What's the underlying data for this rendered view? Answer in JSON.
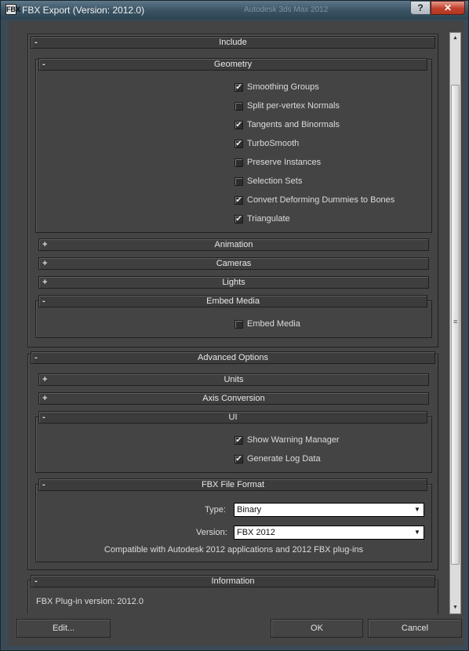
{
  "window": {
    "title": "FBX Export (Version: 2012.0)",
    "icon_label": "FBX",
    "background_title": "Autodesk 3ds Max  2012",
    "help_label": "?",
    "close_label": "✕"
  },
  "include": {
    "label": "Include",
    "toggle": "-",
    "geometry": {
      "label": "Geometry",
      "toggle": "-",
      "options": [
        {
          "label": "Smoothing Groups",
          "checked": true
        },
        {
          "label": "Split per-vertex Normals",
          "checked": false
        },
        {
          "label": "Tangents and Binormals",
          "checked": true
        },
        {
          "label": "TurboSmooth",
          "checked": true
        },
        {
          "label": "Preserve Instances",
          "checked": false
        },
        {
          "label": "Selection Sets",
          "checked": false
        },
        {
          "label": "Convert Deforming Dummies to Bones",
          "checked": true
        },
        {
          "label": "Triangulate",
          "checked": true
        }
      ]
    },
    "animation": {
      "label": "Animation",
      "toggle": "+"
    },
    "cameras": {
      "label": "Cameras",
      "toggle": "+"
    },
    "lights": {
      "label": "Lights",
      "toggle": "+"
    },
    "embed_media": {
      "label": "Embed Media",
      "toggle": "-",
      "option": {
        "label": "Embed Media",
        "checked": false
      }
    }
  },
  "advanced": {
    "label": "Advanced Options",
    "toggle": "-",
    "units": {
      "label": "Units",
      "toggle": "+"
    },
    "axis_conversion": {
      "label": "Axis Conversion",
      "toggle": "+"
    },
    "ui": {
      "label": "UI",
      "toggle": "-",
      "options": [
        {
          "label": "Show Warning Manager",
          "checked": true
        },
        {
          "label": "Generate Log Data",
          "checked": true
        }
      ]
    },
    "fbx_file_format": {
      "label": "FBX File Format",
      "toggle": "-",
      "type_label": "Type:",
      "type_value": "Binary",
      "version_label": "Version:",
      "version_value": "FBX 2012",
      "note": "Compatible with Autodesk 2012 applications and 2012 FBX plug-ins"
    }
  },
  "information": {
    "label": "Information",
    "toggle": "-",
    "plugin_version": "FBX Plug-in version: 2012.0"
  },
  "buttons": {
    "edit": "Edit...",
    "ok": "OK",
    "cancel": "Cancel"
  },
  "scrollbar": {
    "up": "▲",
    "down": "▼",
    "grip": "≡"
  }
}
